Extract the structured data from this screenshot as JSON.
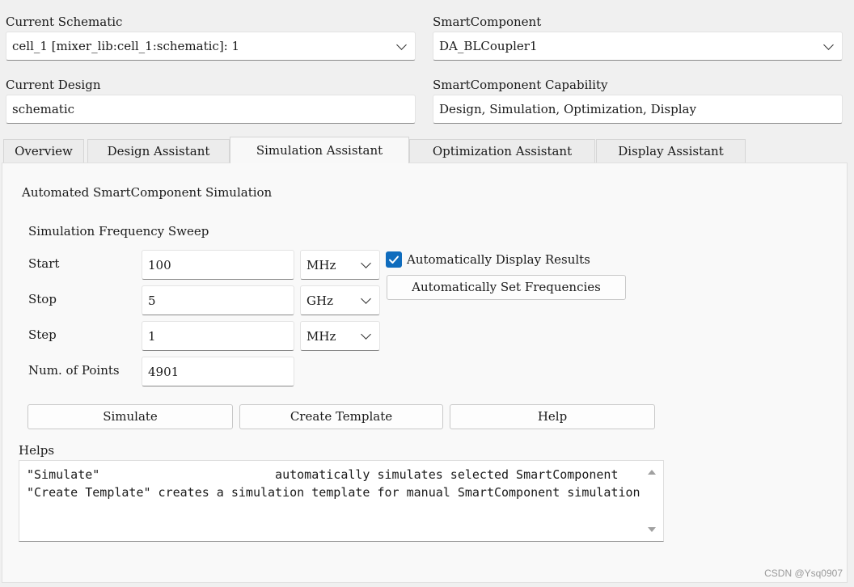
{
  "header": {
    "current_schematic_label": "Current Schematic",
    "current_schematic_value": "cell_1 [mixer_lib:cell_1:schematic]: 1",
    "smart_component_label": "SmartComponent",
    "smart_component_value": "DA_BLCoupler1",
    "current_design_label": "Current Design",
    "current_design_value": "schematic",
    "capability_label": "SmartComponent Capability",
    "capability_value": "Design, Simulation, Optimization, Display"
  },
  "tabs": [
    {
      "label": "Overview"
    },
    {
      "label": "Design Assistant"
    },
    {
      "label": "Simulation Assistant"
    },
    {
      "label": "Optimization Assistant"
    },
    {
      "label": "Display Assistant"
    }
  ],
  "sim": {
    "section_title": "Automated SmartComponent Simulation",
    "sweep_title": "Simulation Frequency Sweep",
    "start_label": "Start",
    "start_value": "100",
    "start_unit": "MHz",
    "stop_label": "Stop",
    "stop_value": "5",
    "stop_unit": "GHz",
    "step_label": "Step",
    "step_value": "1",
    "step_unit": "MHz",
    "points_label": "Num. of Points",
    "points_value": "4901",
    "auto_display_label": "Automatically Display Results",
    "auto_display_checked": true,
    "auto_set_freq_label": "Automatically Set Frequencies",
    "simulate_label": "Simulate",
    "create_template_label": "Create Template",
    "help_label": "Help"
  },
  "helps": {
    "title": "Helps",
    "line1": "\"Simulate\"                        automatically simulates selected SmartComponent",
    "line2": "\"Create Template\" creates a simulation template for manual SmartComponent simulation"
  },
  "watermark": "CSDN @Ysq0907",
  "colors": {
    "accent": "#0f6cbd"
  }
}
